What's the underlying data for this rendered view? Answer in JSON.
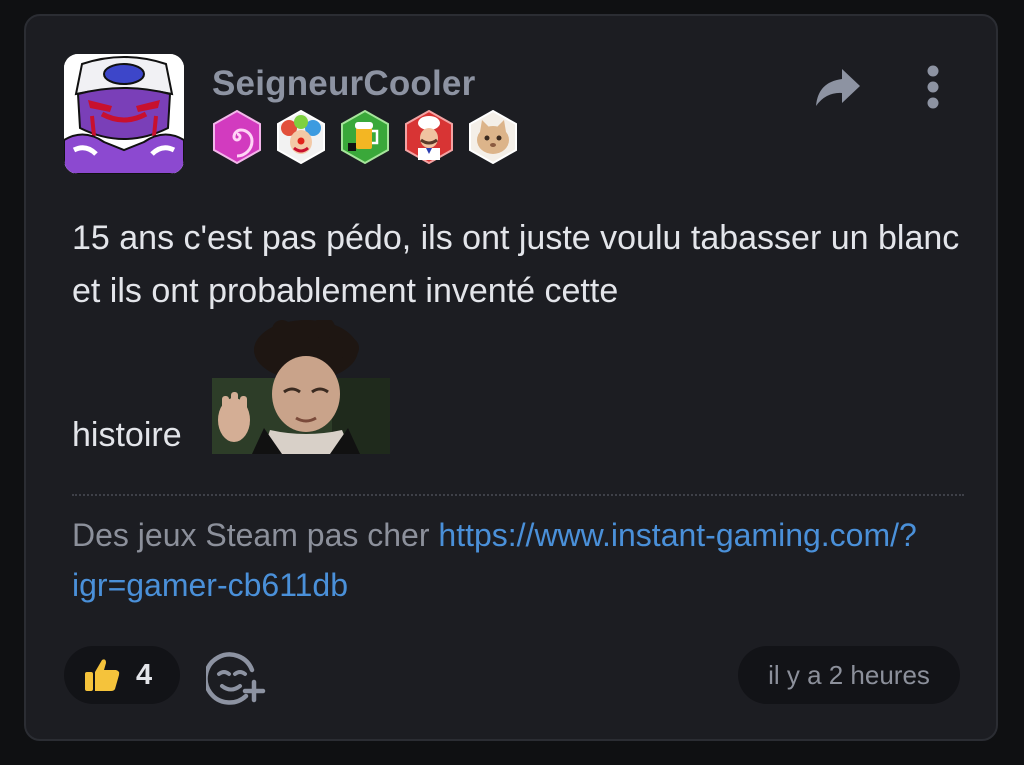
{
  "post": {
    "author": {
      "username": "SeigneurCooler",
      "avatar_icon": "purple-villain-avatar",
      "badges": [
        {
          "name": "spiral-badge-icon",
          "color": "#d23bbf"
        },
        {
          "name": "clown-badge-icon",
          "color": "#e2503b"
        },
        {
          "name": "beer-badge-icon",
          "color": "#3aa83a"
        },
        {
          "name": "chef-badge-icon",
          "color": "#d83434"
        },
        {
          "name": "cat-badge-icon",
          "color": "#e9c9a6"
        }
      ]
    },
    "actions": {
      "share_icon": "share-icon",
      "more_icon": "more-vertical-icon"
    },
    "body": {
      "text": "15 ans c'est pas pédo, ils ont juste voulu tabasser un blanc et ils ont probablement inventé cette",
      "last_word": "histoire",
      "sticker": "man-gesturing-sticker"
    },
    "signature": {
      "prefix": "Des jeux Steam pas cher ",
      "link_text": "https://www.instant-gaming.com/?igr=gamer-cb611db"
    },
    "footer": {
      "like_count": "4",
      "like_icon": "thumbs-up-icon",
      "react_icon": "add-reaction-icon",
      "timestamp": "il y a 2 heures"
    }
  },
  "colors": {
    "background": "#0f1012",
    "card": "#1c1d22",
    "username": "#8d93a2",
    "text": "#e3e5ea",
    "muted": "#8c909b",
    "link": "#4a90d9",
    "pill": "#121317",
    "like_icon": "#f5c33b"
  }
}
